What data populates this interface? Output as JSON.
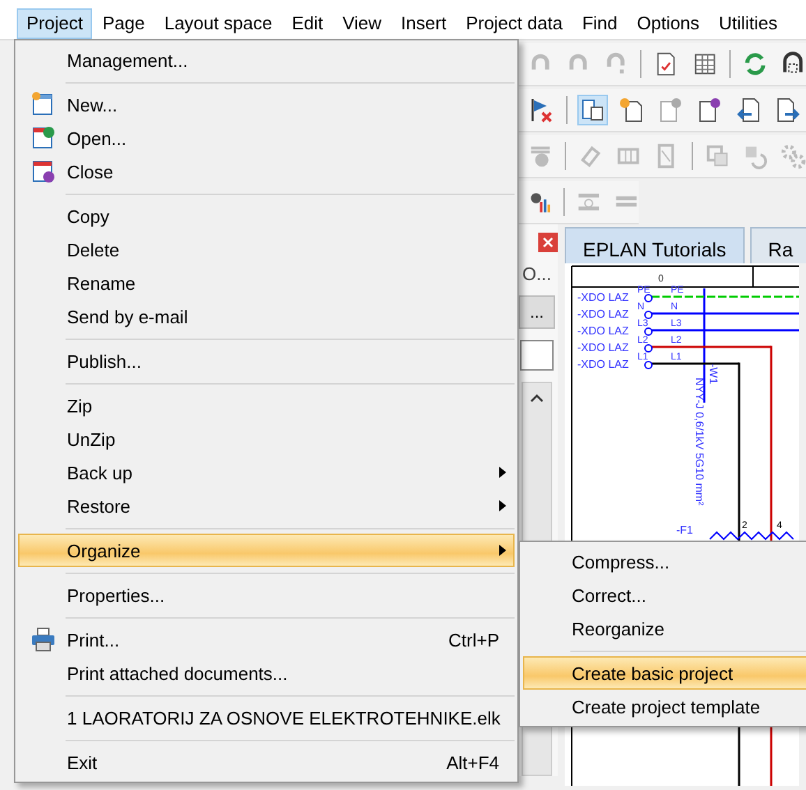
{
  "menu_bar": [
    {
      "label": "Project",
      "selected": true
    },
    {
      "label": "Page",
      "selected": false
    },
    {
      "label": "Layout space",
      "selected": false
    },
    {
      "label": "Edit",
      "selected": false
    },
    {
      "label": "View",
      "selected": false
    },
    {
      "label": "Insert",
      "selected": false
    },
    {
      "label": "Project data",
      "selected": false
    },
    {
      "label": "Find",
      "selected": false
    },
    {
      "label": "Options",
      "selected": false
    },
    {
      "label": "Utilities",
      "selected": false
    }
  ],
  "project_menu": {
    "items": [
      {
        "kind": "item",
        "label": "Management...",
        "selected": false
      },
      {
        "kind": "separator"
      },
      {
        "kind": "new",
        "label": "New...",
        "selected": false
      },
      {
        "kind": "open",
        "label": "Open...",
        "selected": false
      },
      {
        "kind": "close",
        "label": "Close",
        "selected": false
      },
      {
        "kind": "separator"
      },
      {
        "kind": "item",
        "label": "Copy",
        "selected": false
      },
      {
        "kind": "item",
        "label": "Delete",
        "selected": false
      },
      {
        "kind": "item",
        "label": "Rename",
        "selected": false
      },
      {
        "kind": "item",
        "label": "Send by e-mail",
        "selected": false
      },
      {
        "kind": "separator"
      },
      {
        "kind": "item",
        "label": "Publish...",
        "selected": false
      },
      {
        "kind": "separator"
      },
      {
        "kind": "item",
        "label": "Zip",
        "selected": false
      },
      {
        "kind": "item",
        "label": "UnZip",
        "selected": false
      },
      {
        "kind": "item",
        "label": "Back up",
        "submenu": true,
        "selected": false
      },
      {
        "kind": "item",
        "label": "Restore",
        "submenu": true,
        "selected": false
      },
      {
        "kind": "separator"
      },
      {
        "kind": "item",
        "label": "Organize",
        "submenu": true,
        "selected": true
      },
      {
        "kind": "separator"
      },
      {
        "kind": "item",
        "label": "Properties...",
        "selected": false
      },
      {
        "kind": "separator"
      },
      {
        "kind": "print",
        "label": "Print...",
        "shortcut": "Ctrl+P",
        "selected": false
      },
      {
        "kind": "item",
        "label": "Print attached documents...",
        "selected": false
      },
      {
        "kind": "separator"
      },
      {
        "kind": "item",
        "label": "1 LAORATORIJ ZA OSNOVE ELEKTROTEHNIKE.elk",
        "selected": false
      },
      {
        "kind": "separator"
      },
      {
        "kind": "item",
        "label": "Exit",
        "shortcut": "Alt+F4",
        "selected": false
      }
    ]
  },
  "organize_submenu": {
    "items": [
      {
        "kind": "item",
        "label": "Compress...",
        "selected": false
      },
      {
        "kind": "item",
        "label": "Correct...",
        "selected": false
      },
      {
        "kind": "item",
        "label": "Reorganize",
        "selected": false
      },
      {
        "kind": "separator"
      },
      {
        "kind": "item",
        "label": "Create basic project",
        "selected": true
      },
      {
        "kind": "item",
        "label": "Create project template",
        "selected": false
      }
    ]
  },
  "dock_panel": {
    "text": "O...",
    "button": "..."
  },
  "document_tabs": [
    {
      "label": "EPLAN Tutorials",
      "selected": true
    },
    {
      "label": "Ra",
      "selected": false
    }
  ],
  "schematic": {
    "column_header": "0",
    "terminals": [
      {
        "name": "-XDO LAZ",
        "wire_in": "PE",
        "wire_out": "PE",
        "color": "#00cc00"
      },
      {
        "name": "-XDO LAZ",
        "wire_in": "N",
        "wire_out": "N",
        "color": "#0000ff"
      },
      {
        "name": "-XDO LAZ",
        "wire_in": "L3",
        "wire_out": "L3",
        "color": "#0000ff"
      },
      {
        "name": "-XDO LAZ",
        "wire_in": "L2",
        "wire_out": "L2",
        "color": "#cc0000"
      },
      {
        "name": "-XDO LAZ",
        "wire_in": "L1",
        "wire_out": "L1",
        "color": "#000000"
      }
    ],
    "cable_type": "NYY-J 0,6/1kV 5G10 mm²",
    "cable_name": "-W1",
    "device": "-F1",
    "pins": [
      "2",
      "4"
    ]
  }
}
